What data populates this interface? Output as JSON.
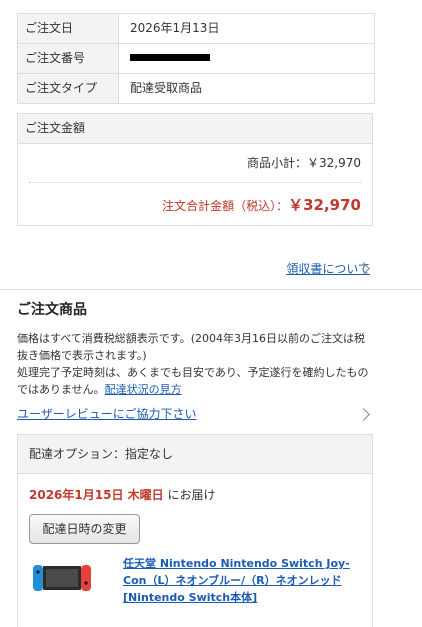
{
  "order_info": {
    "rows": [
      {
        "label": "ご注文日",
        "value": "2026年1月13日"
      },
      {
        "label": "ご注文番号",
        "value": ""
      },
      {
        "label": "ご注文タイプ",
        "value": "配達受取商品"
      }
    ]
  },
  "amount": {
    "heading": "ご注文金額",
    "subtotal": "商品小計：￥32,970",
    "total_label": "注文合計金額（税込）：",
    "total_value": "￥32,970"
  },
  "receipt_link": "領収書について",
  "products": {
    "title": "ご注文商品",
    "notice_1": "価格はすべて消費税総額表示です。(2004年3月16日以前のご注文は税抜き価格で表示されます。)",
    "notice_2": "処理完了予定時刻は、あくまでも目安であり、予定遂行を確約したものではありません。",
    "status_link": "配達状況の見方",
    "review_link": "ユーザーレビューにご協力下さい"
  },
  "delivery": {
    "option": "配達オプション：指定なし",
    "date": "2026年1月15日 木曜日",
    "date_suffix": "にお届け",
    "change_button": "配達日時の変更",
    "product_name": "任天堂 Nintendo Nintendo Switch Joy-Con（L）ネオンブルー/（R）ネオンレッド [Nintendo Switch本体]"
  },
  "colors": {
    "link": "#1a5bb5",
    "accent_red": "#c0392b"
  }
}
